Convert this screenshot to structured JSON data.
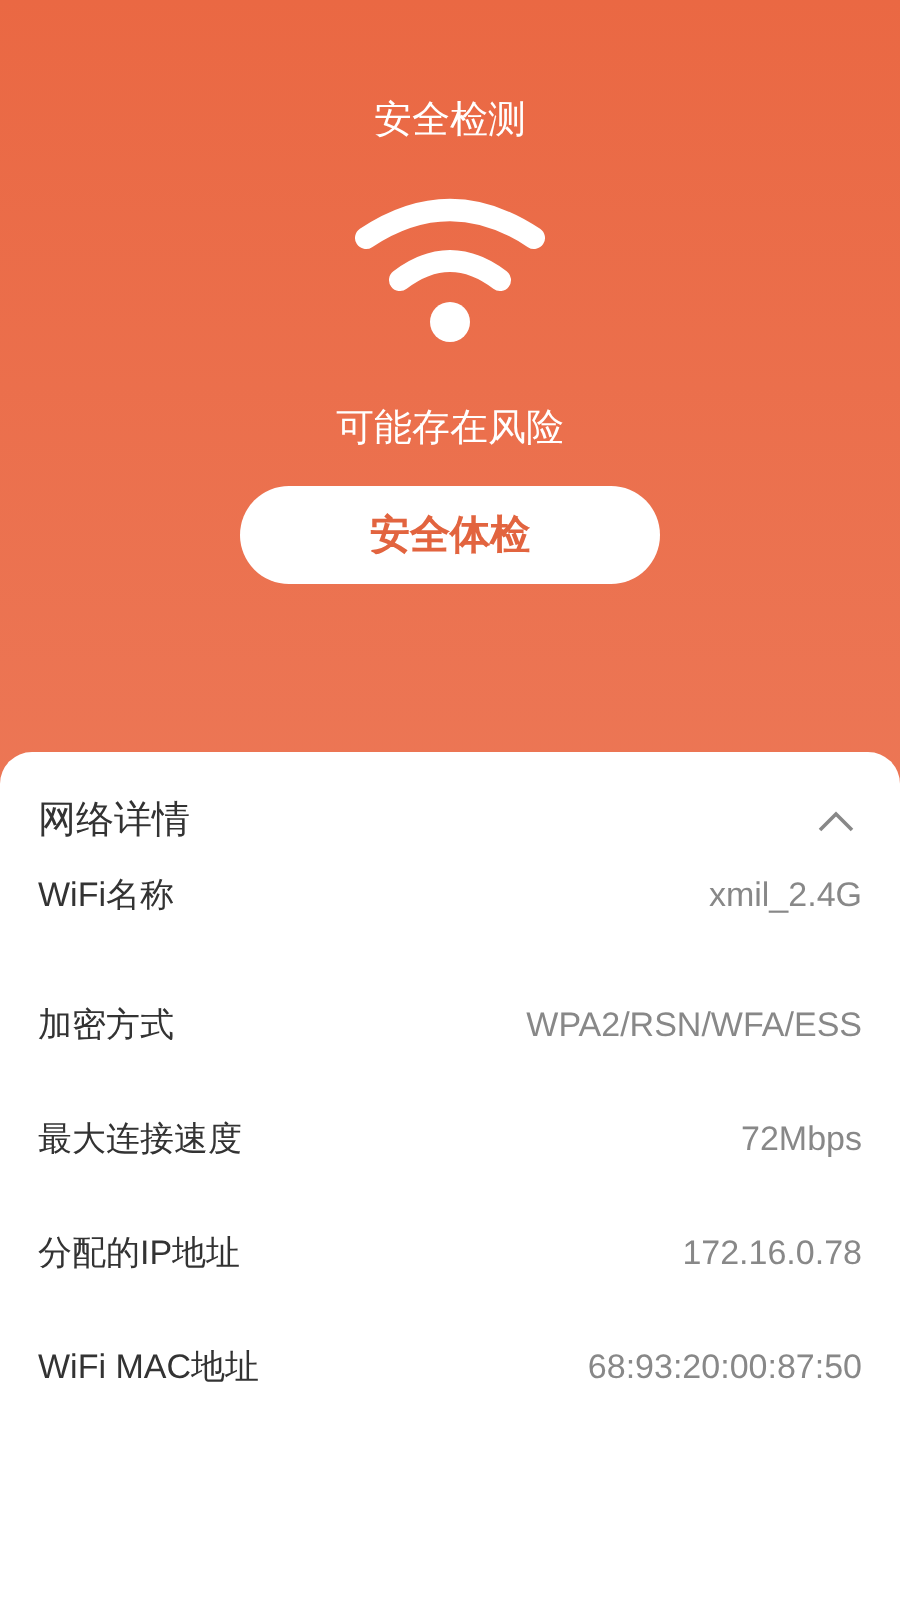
{
  "header": {
    "title": "安全检测",
    "status": "可能存在风险",
    "button": "安全体检"
  },
  "details": {
    "title": "网络详情",
    "expanded": true,
    "rows": [
      {
        "label": "WiFi名称",
        "value": "xmil_2.4G"
      },
      {
        "label": "加密方式",
        "value": "WPA2/RSN/WFA/ESS"
      },
      {
        "label": "最大连接速度",
        "value": "72Mbps"
      },
      {
        "label": "分配的IP地址",
        "value": "172.16.0.78"
      },
      {
        "label": "WiFi MAC地址",
        "value": "68:93:20:00:87:50"
      }
    ]
  }
}
